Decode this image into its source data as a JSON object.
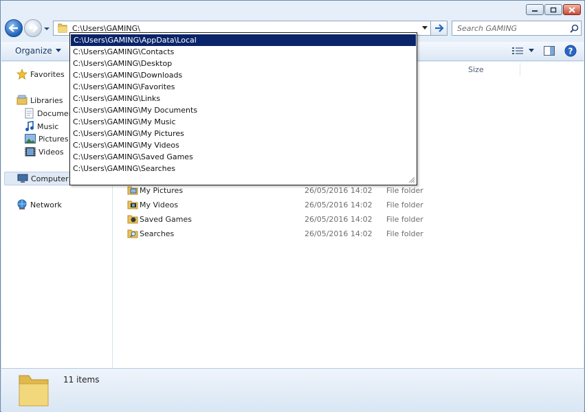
{
  "window": {
    "controls": {
      "minimize": "minimize",
      "maximize": "maximize",
      "close": "close"
    }
  },
  "address": {
    "path": "C:\\Users\\GAMING\\"
  },
  "search": {
    "placeholder": "Search GAMING"
  },
  "toolbar": {
    "organize_label": "Organize"
  },
  "nav": {
    "favorites": "Favorites",
    "libraries": "Libraries",
    "documents": "Documents",
    "music": "Music",
    "pictures": "Pictures",
    "videos": "Videos",
    "computer": "Computer",
    "network": "Network"
  },
  "columns": {
    "size": "Size"
  },
  "files": [
    {
      "name": "My Pictures",
      "date": "26/05/2016 14:02",
      "type": "File folder",
      "icon": "pictures-folder-icon"
    },
    {
      "name": "My Videos",
      "date": "26/05/2016 14:02",
      "type": "File folder",
      "icon": "videos-folder-icon"
    },
    {
      "name": "Saved Games",
      "date": "26/05/2016 14:02",
      "type": "File folder",
      "icon": "saved-games-folder-icon"
    },
    {
      "name": "Searches",
      "date": "26/05/2016 14:02",
      "type": "File folder",
      "icon": "searches-folder-icon"
    }
  ],
  "autocomplete": [
    "C:\\Users\\GAMING\\AppData\\Local",
    "C:\\Users\\GAMING\\Contacts",
    "C:\\Users\\GAMING\\Desktop",
    "C:\\Users\\GAMING\\Downloads",
    "C:\\Users\\GAMING\\Favorites",
    "C:\\Users\\GAMING\\Links",
    "C:\\Users\\GAMING\\My Documents",
    "C:\\Users\\GAMING\\My Music",
    "C:\\Users\\GAMING\\My Pictures",
    "C:\\Users\\GAMING\\My Videos",
    "C:\\Users\\GAMING\\Saved Games",
    "C:\\Users\\GAMING\\Searches"
  ],
  "status": {
    "item_count": "11 items"
  },
  "colors": {
    "selection": "#0a246a",
    "accent": "#1f5fb6"
  }
}
